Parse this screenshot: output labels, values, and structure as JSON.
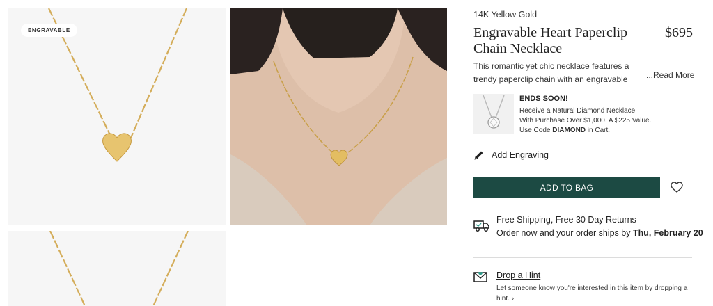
{
  "gallery": {
    "badge": "ENGRAVABLE",
    "images": [
      {
        "subject": "heart pendant necklace on white background"
      },
      {
        "subject": "model wearing heart pendant necklace"
      },
      {
        "subject": "necklace chain detail"
      }
    ]
  },
  "product": {
    "metal": "14K Yellow Gold",
    "title": "Engravable Heart Paperclip Chain Necklace",
    "price": "$695",
    "description": "This romantic yet chic necklace features a trendy paperclip chain with an engravable heart-shaped pendant",
    "read_more_dots": "...",
    "read_more": "Read More"
  },
  "promo": {
    "title": "ENDS SOON!",
    "line1": "Receive a Natural Diamond Necklace",
    "line2": "With Purchase Over $1,000. A $225 Value.",
    "line3_prefix": "Use Code ",
    "code": "DIAMOND",
    "line3_suffix": " in Cart."
  },
  "engraving": {
    "label": "Add Engraving",
    "icon": "pencil-icon"
  },
  "cart": {
    "add_label": "ADD TO BAG",
    "wishlist_icon": "heart-outline-icon",
    "button_color": "#1c4a43"
  },
  "shipping": {
    "icon": "delivery-truck-icon",
    "line1": "Free Shipping, Free 30 Day Returns",
    "line2_prefix": "Order now and your order ships by ",
    "ship_date": "Thu, February 20"
  },
  "hint": {
    "icon": "envelope-heart-icon",
    "label": "Drop a Hint",
    "text": "Let someone know you're interested in this item by dropping a hint.",
    "arrow": "›"
  }
}
